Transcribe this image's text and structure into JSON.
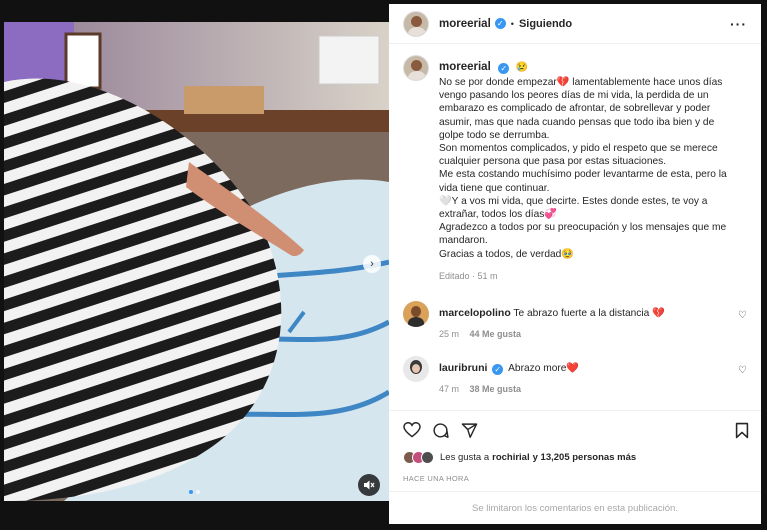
{
  "post": {
    "username": "moreerial",
    "follow_status": "Siguiendo",
    "separator": "•",
    "more_icon": "more-horizontal-icon"
  },
  "caption": {
    "username": "moreerial",
    "emoji_after_name": "😢",
    "paragraphs": [
      "No se por donde empezar💔 lamentablemente hace unos días vengo pasando los peores días de mi vida, la perdida de un embarazo es complicado de afrontar, de sobrellevar y poder asumir, mas que nada cuando pensas que todo iba bien y de golpe todo se derrumba.",
      "Son momentos complicados, y pido el respeto que se merece cualquier persona que pasa por estas situaciones.",
      "Me esta costando muchísimo poder levantarme de esta, pero la vida tiene que continuar.",
      "🤍Y a vos mi vida, que decirte. Estes donde estes, te voy a extrañar, todos los días💞",
      "Agradezco a todos por su preocupación y los mensajes que me mandaron.",
      "Gracias a todos, de verdad🥹"
    ],
    "edited": "Editado · 51 m"
  },
  "comments": [
    {
      "username": "marcelopolino",
      "verified": false,
      "text": "Te abrazo fuerte a la distancia 💔",
      "time": "25 m",
      "likes": "44 Me gusta"
    },
    {
      "username": "lauribruni",
      "verified": true,
      "text": "Abrazo more❤️",
      "time": "47 m",
      "likes": "38 Me gusta"
    }
  ],
  "likes": {
    "prefix": "Les gusta a",
    "user": "rochirial",
    "suffix": "y 13,205 personas más"
  },
  "timestamp": "HACE UNA HORA",
  "comments_limited": "Se limitaron los comentarios en esta publicación.",
  "colors": {
    "verified": "#3897f0",
    "heart": "#ed4956",
    "text": "#262626",
    "muted": "#8e8e8e"
  }
}
